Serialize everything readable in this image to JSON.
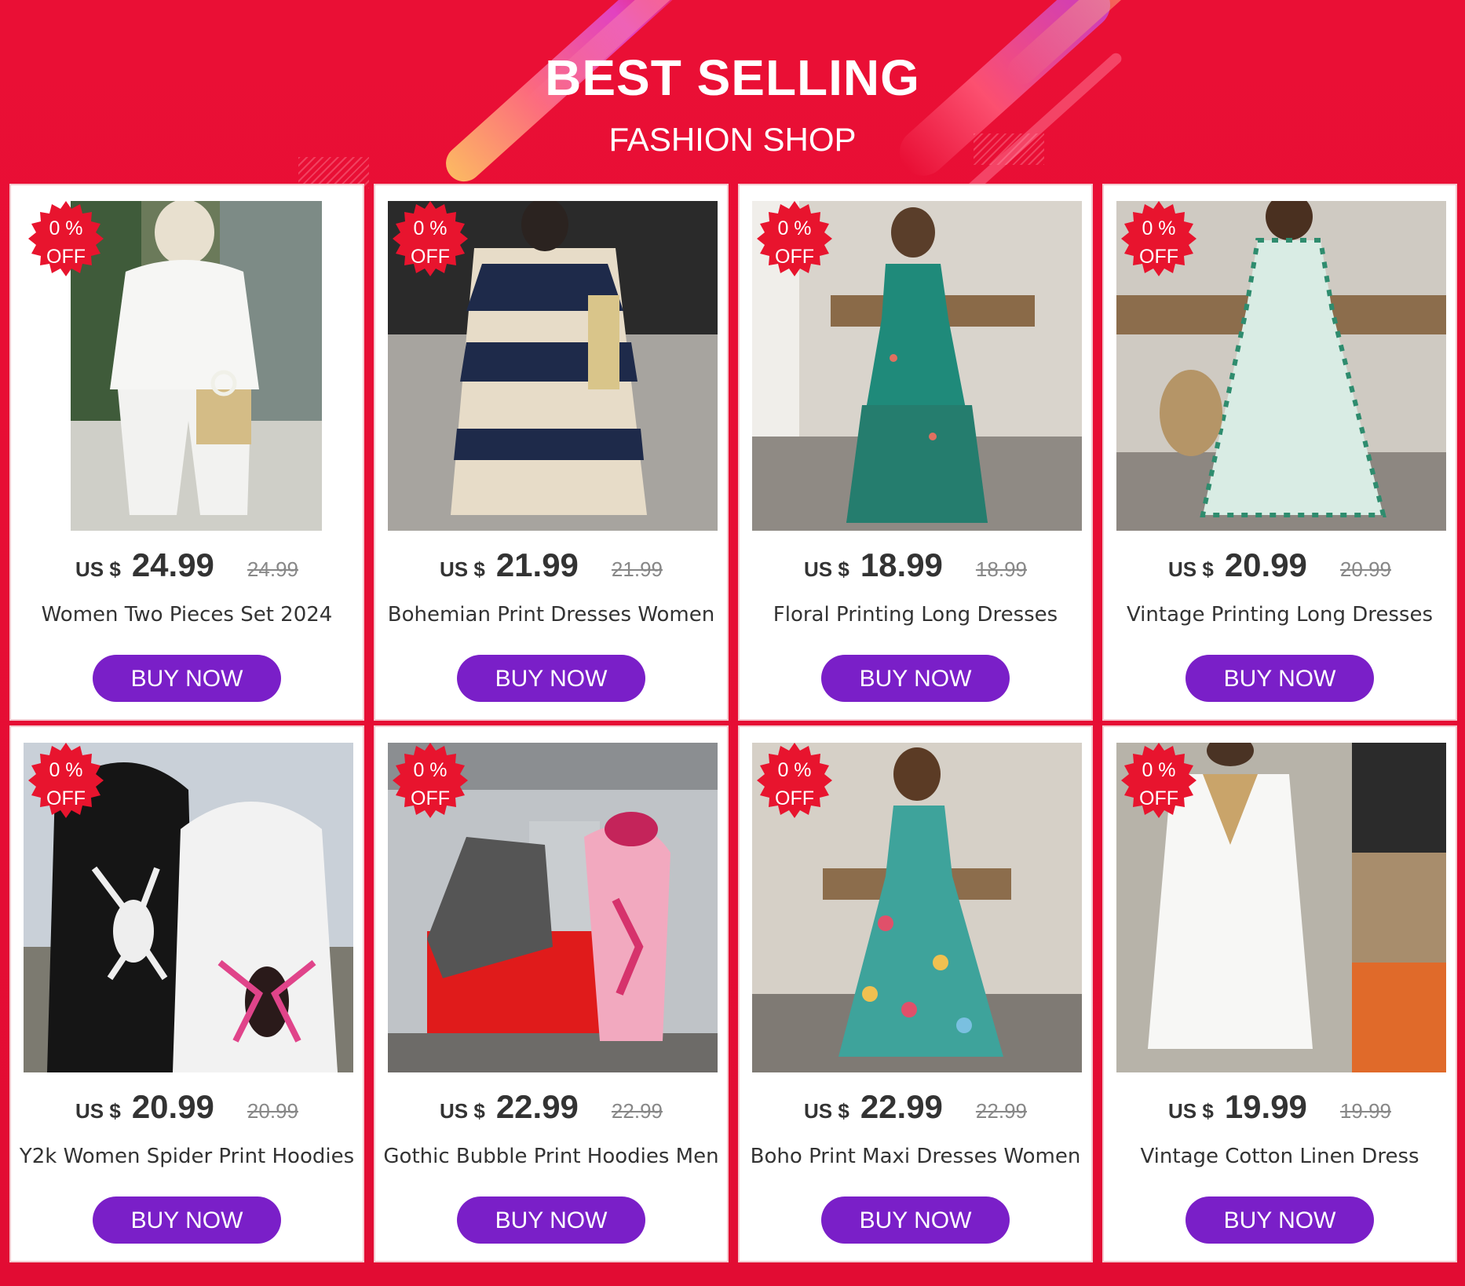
{
  "header": {
    "title": "BEST SELLING",
    "subtitle": "FASHION SHOP"
  },
  "colors": {
    "background": "#e60c33",
    "button": "#7a1fc8",
    "badge": "#e8142e"
  },
  "products": [
    {
      "badge_line1": "0 %",
      "badge_line2": "OFF",
      "currency": "US $",
      "price": "24.99",
      "old_price": "24.99",
      "name": "Women Two Pieces Set 2024",
      "button": "BUY NOW",
      "image": "white-two-piece-set-photo"
    },
    {
      "badge_line1": "0 %",
      "badge_line2": "OFF",
      "currency": "US $",
      "price": "21.99",
      "old_price": "21.99",
      "name": "Bohemian Print Dresses Women",
      "button": "BUY NOW",
      "image": "bohemian-print-dress-photo"
    },
    {
      "badge_line1": "0 %",
      "badge_line2": "OFF",
      "currency": "US $",
      "price": "18.99",
      "old_price": "18.99",
      "name": "Floral Printing Long Dresses",
      "button": "BUY NOW",
      "image": "green-floral-long-dress-photo"
    },
    {
      "badge_line1": "0 %",
      "badge_line2": "OFF",
      "currency": "US $",
      "price": "20.99",
      "old_price": "20.99",
      "name": "Vintage Printing Long Dresses",
      "button": "BUY NOW",
      "image": "green-vintage-print-dress-photo"
    },
    {
      "badge_line1": "0 %",
      "badge_line2": "OFF",
      "currency": "US $",
      "price": "20.99",
      "old_price": "20.99",
      "name": "Y2k Women Spider Print Hoodies",
      "button": "BUY NOW",
      "image": "spider-print-hoodies-photo"
    },
    {
      "badge_line1": "0 %",
      "badge_line2": "OFF",
      "currency": "US $",
      "price": "22.99",
      "old_price": "22.99",
      "name": "Gothic Bubble Print Hoodies Men",
      "button": "BUY NOW",
      "image": "bubble-print-hoodies-photo"
    },
    {
      "badge_line1": "0 %",
      "badge_line2": "OFF",
      "currency": "US $",
      "price": "22.99",
      "old_price": "22.99",
      "name": "Boho Print Maxi Dresses Women",
      "button": "BUY NOW",
      "image": "boho-maxi-dress-photo"
    },
    {
      "badge_line1": "0 %",
      "badge_line2": "OFF",
      "currency": "US $",
      "price": "19.99",
      "old_price": "19.99",
      "name": "Vintage Cotton Linen Dress",
      "button": "BUY NOW",
      "image": "cotton-linen-dress-photo"
    }
  ]
}
